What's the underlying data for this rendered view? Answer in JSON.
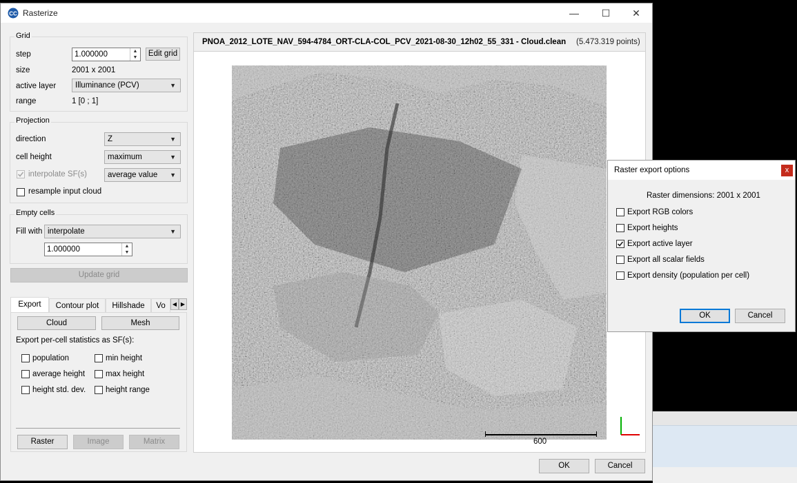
{
  "window": {
    "title": "Rasterize",
    "min": "—",
    "max": "☐",
    "close": "✕"
  },
  "grid": {
    "group_label": "Grid",
    "step_label": "step",
    "step_value": "1.000000",
    "edit_grid": "Edit grid",
    "size_label": "size",
    "size_value": "2001 x 2001",
    "active_layer_label": "active layer",
    "active_layer_value": "Illuminance (PCV)",
    "range_label": "range",
    "range_value": "1 [0 ; 1]"
  },
  "projection": {
    "group_label": "Projection",
    "direction_label": "direction",
    "direction_value": "Z",
    "cell_height_label": "cell height",
    "cell_height_value": "maximum",
    "interpolate_label": "interpolate SF(s)",
    "interpolate_value": "average value",
    "resample_label": "resample input cloud"
  },
  "empty_cells": {
    "group_label": "Empty cells",
    "fill_label": "Fill with",
    "fill_value": "interpolate",
    "fill_number": "1.000000"
  },
  "update_grid": "Update grid",
  "tabs": [
    "Export",
    "Contour plot",
    "Hillshade",
    "Vo"
  ],
  "export_tab": {
    "cloud": "Cloud",
    "mesh": "Mesh",
    "stats_label": "Export per-cell statistics as SF(s):",
    "stats_left": [
      "population",
      "average height",
      "height std. dev."
    ],
    "stats_right": [
      "min height",
      "max height",
      "height range"
    ],
    "raster": "Raster",
    "image": "Image",
    "matrix": "Matrix"
  },
  "view": {
    "title_bold": "PNOA_2012_LOTE_NAV_594-4784_ORT-CLA-COL_PCV_2021-08-30_12h02_55_331 - Cloud.clean",
    "title_points": "(5.473.319 points)",
    "scale_label": "600"
  },
  "buttons": {
    "ok": "OK",
    "cancel": "Cancel"
  },
  "export_dialog": {
    "title": "Raster export options",
    "close": "x",
    "dimensions": "Raster dimensions:  2001 x 2001",
    "options": [
      {
        "label": "Export RGB colors",
        "checked": false
      },
      {
        "label": "Export heights",
        "checked": false
      },
      {
        "label": "Export active layer",
        "checked": true
      },
      {
        "label": "Export all scalar fields",
        "checked": false
      },
      {
        "label": "Export density (population per cell)",
        "checked": false
      }
    ],
    "ok": "OK",
    "cancel": "Cancel"
  },
  "colors": {
    "accent": "#0078d7",
    "close_red": "#c42b1c",
    "axis_x": "#e00000",
    "axis_y": "#00b000"
  }
}
